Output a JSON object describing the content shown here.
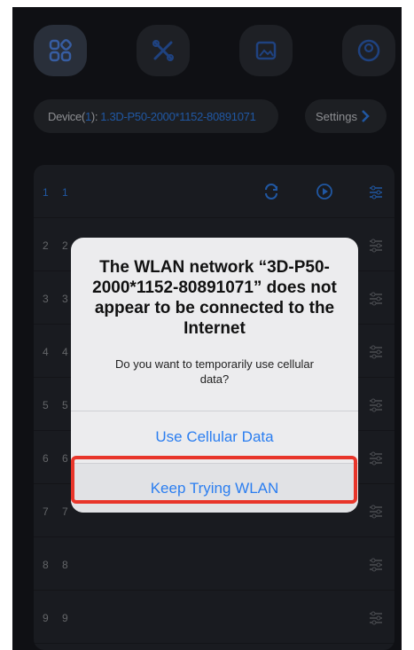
{
  "tabs": [
    {
      "icon": "grid-icon",
      "active": true
    },
    {
      "icon": "tools-icon",
      "active": false
    },
    {
      "icon": "image-icon",
      "active": false
    },
    {
      "icon": "user-icon",
      "active": false
    }
  ],
  "device_bar": {
    "label": "Device(",
    "count": "1",
    "label_close": "): ",
    "value": "1.3D-P50-2000*1152-80891071"
  },
  "settings_button": {
    "label": "Settings"
  },
  "rows": [
    {
      "index": "1",
      "number": "1",
      "active": true
    },
    {
      "index": "2",
      "number": "2"
    },
    {
      "index": "3",
      "number": "3"
    },
    {
      "index": "4",
      "number": "4"
    },
    {
      "index": "5",
      "number": "5"
    },
    {
      "index": "6",
      "number": "6"
    },
    {
      "index": "7",
      "number": "7"
    },
    {
      "index": "8",
      "number": "8"
    },
    {
      "index": "9",
      "number": "9"
    }
  ],
  "alert": {
    "title": "The WLAN network “3D-P50-2000*1152-80891071” does not appear to be connected to the Internet",
    "message": "Do you want to temporarily use cellular data?",
    "primary_button": "Use Cellular Data",
    "secondary_button": "Keep Trying WLAN"
  },
  "colors": {
    "accent": "#2e7de9",
    "highlight": "#e8352a",
    "background": "#16181d"
  }
}
